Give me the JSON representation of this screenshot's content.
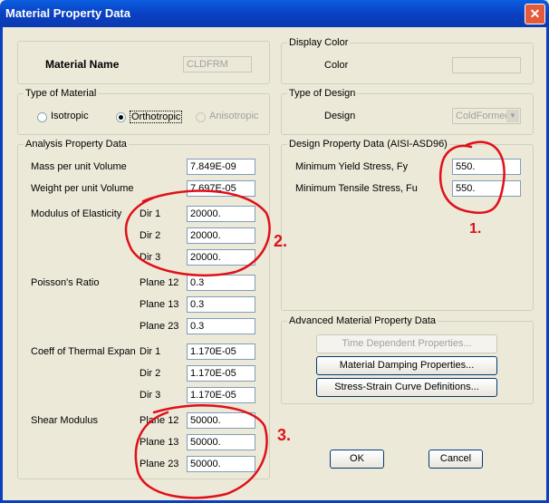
{
  "window": {
    "title": "Material Property Data",
    "close_glyph": "✕"
  },
  "material": {
    "name_label": "Material Name",
    "name_value": "CLDFRM"
  },
  "type_of_material": {
    "legend": "Type of Material",
    "options": [
      "Isotropic",
      "Orthotropic",
      "Anisotropic"
    ],
    "selected": "Orthotropic"
  },
  "analysis": {
    "legend": "Analysis Property Data",
    "mass_label": "Mass per unit Volume",
    "mass_value": "7.849E-09",
    "weight_label": "Weight per unit Volume",
    "weight_value": "7.697E-05",
    "modulus_label": "Modulus of Elasticity",
    "modulus": [
      {
        "dir": "Dir 1",
        "value": "20000."
      },
      {
        "dir": "Dir 2",
        "value": "20000."
      },
      {
        "dir": "Dir 3",
        "value": "20000."
      }
    ],
    "poisson_label": "Poisson's Ratio",
    "poisson": [
      {
        "plane": "Plane 12",
        "value": "0.3"
      },
      {
        "plane": "Plane 13",
        "value": "0.3"
      },
      {
        "plane": "Plane 23",
        "value": "0.3"
      }
    ],
    "thermal_label": "Coeff of Thermal Expan",
    "thermal": [
      {
        "dir": "Dir 1",
        "value": "1.170E-05"
      },
      {
        "dir": "Dir 2",
        "value": "1.170E-05"
      },
      {
        "dir": "Dir 3",
        "value": "1.170E-05"
      }
    ],
    "shear_label": "Shear Modulus",
    "shear": [
      {
        "plane": "Plane 12",
        "value": "50000."
      },
      {
        "plane": "Plane 13",
        "value": "50000."
      },
      {
        "plane": "Plane 23",
        "value": "50000."
      }
    ]
  },
  "display_color": {
    "legend": "Display Color",
    "color_label": "Color"
  },
  "type_of_design": {
    "legend": "Type of Design",
    "design_label": "Design",
    "design_value": "ColdFormed"
  },
  "design_property": {
    "legend": "Design Property Data (AISI-ASD96)",
    "fy_label": "Minimum Yield Stress, Fy",
    "fy_value": "550.",
    "fu_label": "Minimum Tensile Stress, Fu",
    "fu_value": "550."
  },
  "advanced": {
    "legend": "Advanced Material Property Data",
    "time_dep": "Time Dependent Properties...",
    "damping": "Material Damping Properties...",
    "stress_strain": "Stress-Strain Curve Definitions..."
  },
  "buttons": {
    "ok": "OK",
    "cancel": "Cancel"
  },
  "annotations": {
    "mark1": "1.",
    "mark2": "2.",
    "mark3": "3."
  },
  "colors": {
    "annotation": "#e0101a",
    "titlebar": "#0a3fc0"
  }
}
